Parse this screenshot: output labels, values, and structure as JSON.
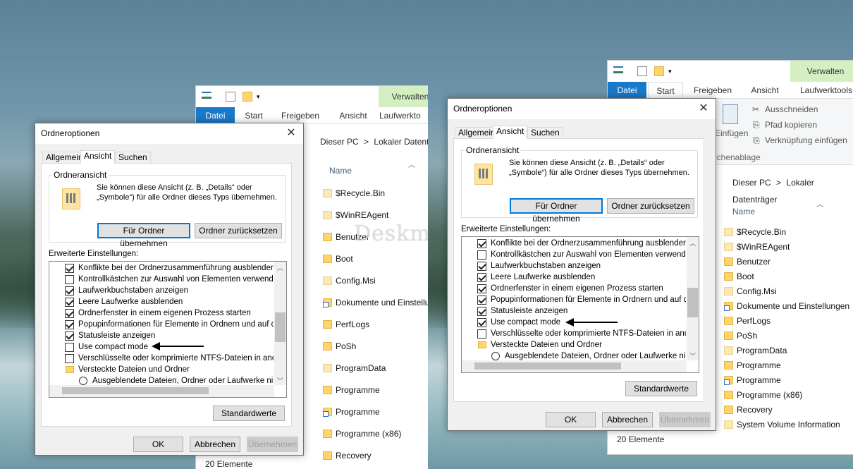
{
  "left": {
    "explorer": {
      "ctx_tab": "Verwalten",
      "tabs": [
        "Datei",
        "Start",
        "Freigeben",
        "Ansicht",
        "Laufwerkto"
      ],
      "address": [
        "Dieser PC",
        ">",
        "Lokaler Datentr"
      ],
      "col_name": "Name",
      "items": [
        {
          "name": "$Recycle.Bin",
          "kind": "lt"
        },
        {
          "name": "$WinREAgent",
          "kind": "lt"
        },
        {
          "name": "Benutzer",
          "kind": "n"
        },
        {
          "name": "Boot",
          "kind": "n"
        },
        {
          "name": "Config.Msi",
          "kind": "lt"
        },
        {
          "name": "Dokumente und Einstellu",
          "kind": "lnk"
        },
        {
          "name": "PerfLogs",
          "kind": "n"
        },
        {
          "name": "PoSh",
          "kind": "n"
        },
        {
          "name": "ProgramData",
          "kind": "lt"
        },
        {
          "name": "Programme",
          "kind": "n"
        },
        {
          "name": "Programme",
          "kind": "lnk"
        },
        {
          "name": "Programme (x86)",
          "kind": "n"
        },
        {
          "name": "Recovery",
          "kind": "n"
        }
      ],
      "status": "20 Elemente"
    },
    "dialog": {
      "title": "Ordneroptionen",
      "tabs": [
        "Allgemein",
        "Ansicht",
        "Suchen"
      ],
      "group_title": "Ordneransicht",
      "group_text": "Sie können diese Ansicht (z. B. „Details“ oder „Symbole“) für alle Ordner dieses Typs übernehmen.",
      "btn_apply_folders": "Für Ordner übernehmen",
      "btn_reset_folders": "Ordner zurücksetzen",
      "advanced_label": "Erweiterte Einstellungen:",
      "rows": [
        {
          "text": "Konflikte bei der Ordnerzusammenführung ausblenden",
          "type": "cb",
          "checked": true
        },
        {
          "text": "Kontrollkästchen zur Auswahl von Elementen verwenden",
          "type": "cb",
          "checked": false
        },
        {
          "text": "Laufwerkbuchstaben anzeigen",
          "type": "cb",
          "checked": true
        },
        {
          "text": "Leere Laufwerke ausblenden",
          "type": "cb",
          "checked": true
        },
        {
          "text": "Ordnerfenster in einem eigenen Prozess starten",
          "type": "cb",
          "checked": true
        },
        {
          "text": "Popupinformationen für Elemente in Ordnern und auf dem D",
          "type": "cb",
          "checked": true
        },
        {
          "text": "Statusleiste anzeigen",
          "type": "cb",
          "checked": true
        },
        {
          "text": "Use compact mode",
          "type": "cb",
          "checked": false
        },
        {
          "text": "Verschlüsselte oder komprimierte NTFS-Dateien in anderer",
          "type": "cb",
          "checked": false
        },
        {
          "text": "Versteckte Dateien und Ordner",
          "type": "folder",
          "checked": false
        },
        {
          "text": "Ausgeblendete Dateien, Ordner oder Laufwerke nicht a",
          "type": "radio",
          "checked": false
        }
      ],
      "btn_defaults": "Standardwerte",
      "btn_ok": "OK",
      "btn_cancel": "Abbrechen",
      "btn_apply": "Übernehmen"
    }
  },
  "right": {
    "explorer": {
      "ctx_tab": "Verwalten",
      "tabs": [
        "Datei",
        "Start",
        "Freigeben",
        "Ansicht",
        "Laufwerktools"
      ],
      "clipboard": [
        "Ausschneiden",
        "Pfad kopieren",
        "Verknüpfung einfügen"
      ],
      "paste_label": "Einfügen",
      "clip_group": "Zwischenablage",
      "address": [
        "Dieser PC",
        ">",
        "Lokaler Datenträger"
      ],
      "col_name": "Name",
      "items": [
        {
          "name": "$Recycle.Bin",
          "kind": "lt"
        },
        {
          "name": "$WinREAgent",
          "kind": "lt"
        },
        {
          "name": "Benutzer",
          "kind": "n"
        },
        {
          "name": "Boot",
          "kind": "n"
        },
        {
          "name": "Config.Msi",
          "kind": "lt"
        },
        {
          "name": "Dokumente und Einstellungen",
          "kind": "lnk"
        },
        {
          "name": "PerfLogs",
          "kind": "n"
        },
        {
          "name": "PoSh",
          "kind": "n"
        },
        {
          "name": "ProgramData",
          "kind": "lt"
        },
        {
          "name": "Programme",
          "kind": "n"
        },
        {
          "name": "Programme",
          "kind": "lnk"
        },
        {
          "name": "Programme (x86)",
          "kind": "n"
        },
        {
          "name": "Recovery",
          "kind": "n"
        },
        {
          "name": "System Volume Information",
          "kind": "lt"
        }
      ],
      "status": "20 Elemente"
    },
    "dialog": {
      "title": "Ordneroptionen",
      "tabs": [
        "Allgemein",
        "Ansicht",
        "Suchen"
      ],
      "group_title": "Ordneransicht",
      "group_text": "Sie können diese Ansicht (z. B. „Details“ oder „Symbole“) für alle Ordner dieses Typs übernehmen.",
      "btn_apply_folders": "Für Ordner übernehmen",
      "btn_reset_folders": "Ordner zurücksetzen",
      "advanced_label": "Erweiterte Einstellungen:",
      "rows": [
        {
          "text": "Konflikte bei der Ordnerzusammenführung ausblenden",
          "type": "cb",
          "checked": true
        },
        {
          "text": "Kontrollkästchen zur Auswahl von Elementen verwenden",
          "type": "cb",
          "checked": false
        },
        {
          "text": "Laufwerkbuchstaben anzeigen",
          "type": "cb",
          "checked": true
        },
        {
          "text": "Leere Laufwerke ausblenden",
          "type": "cb",
          "checked": true
        },
        {
          "text": "Ordnerfenster in einem eigenen Prozess starten",
          "type": "cb",
          "checked": true
        },
        {
          "text": "Popupinformationen für Elemente in Ordnern und auf dem D",
          "type": "cb",
          "checked": true
        },
        {
          "text": "Statusleiste anzeigen",
          "type": "cb",
          "checked": true
        },
        {
          "text": "Use compact mode",
          "type": "cb",
          "checked": true
        },
        {
          "text": "Verschlüsselte oder komprimierte NTFS-Dateien in anderer",
          "type": "cb",
          "checked": false
        },
        {
          "text": "Versteckte Dateien und Ordner",
          "type": "folder",
          "checked": false
        },
        {
          "text": "Ausgeblendete Dateien, Ordner oder Laufwerke nicht a",
          "type": "radio",
          "checked": false
        }
      ],
      "btn_defaults": "Standardwerte",
      "btn_ok": "OK",
      "btn_cancel": "Abbrechen",
      "btn_apply": "Übernehmen"
    }
  },
  "watermark": "Deskmodder.de",
  "colors": {
    "accent": "#0078d7",
    "file_tab": "#1979ca",
    "context_tab": "#d4f0c2",
    "folder": "#ffd56b"
  }
}
